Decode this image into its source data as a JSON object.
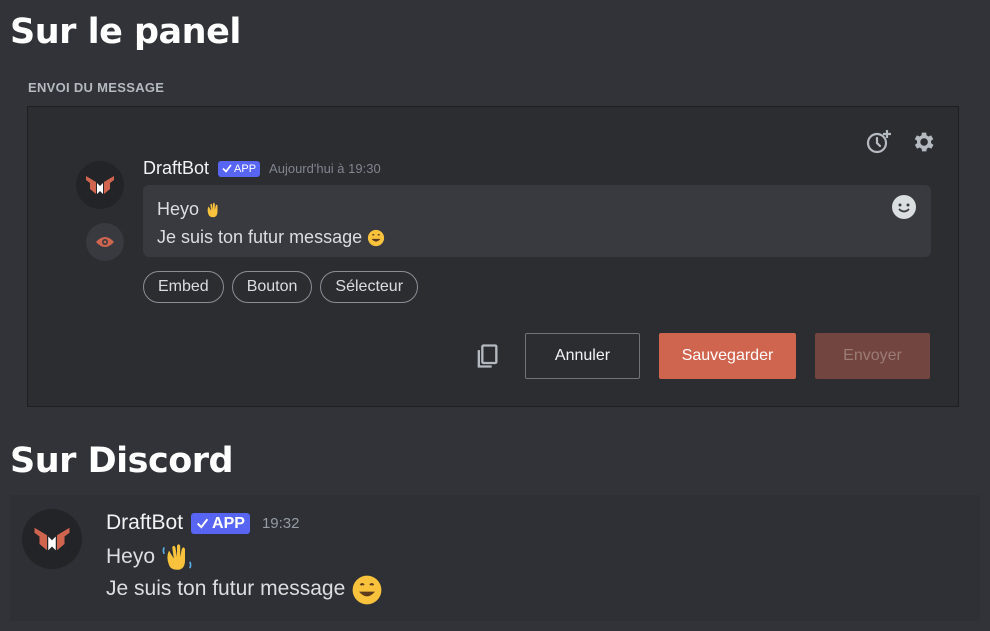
{
  "sections": {
    "panel_title": "Sur le panel",
    "discord_title": "Sur Discord"
  },
  "panel": {
    "label": "ENVOI DU MESSAGE",
    "message": {
      "author": "DraftBot",
      "badge": "APP",
      "timestamp": "Aujourd'hui à 19:30",
      "line1": "Heyo",
      "line2": "Je suis ton futur message"
    },
    "components": [
      "Embed",
      "Bouton",
      "Sélecteur"
    ],
    "buttons": {
      "cancel": "Annuler",
      "save": "Sauvegarder",
      "send": "Envoyer"
    }
  },
  "discord": {
    "author": "DraftBot",
    "badge": "APP",
    "timestamp": "19:32",
    "line1": "Heyo",
    "line2": "Je suis ton futur message"
  },
  "colors": {
    "background": "#313338",
    "panel": "#2b2d31",
    "accent": "#d0654f",
    "badge": "#5865f2"
  },
  "icons": [
    "schedule-icon",
    "gear-icon",
    "eye-icon",
    "emoji-picker-icon",
    "copy-icon",
    "waving-hand-emoji",
    "grinning-face-emoji",
    "draftbot-logo",
    "checkmark-icon"
  ]
}
